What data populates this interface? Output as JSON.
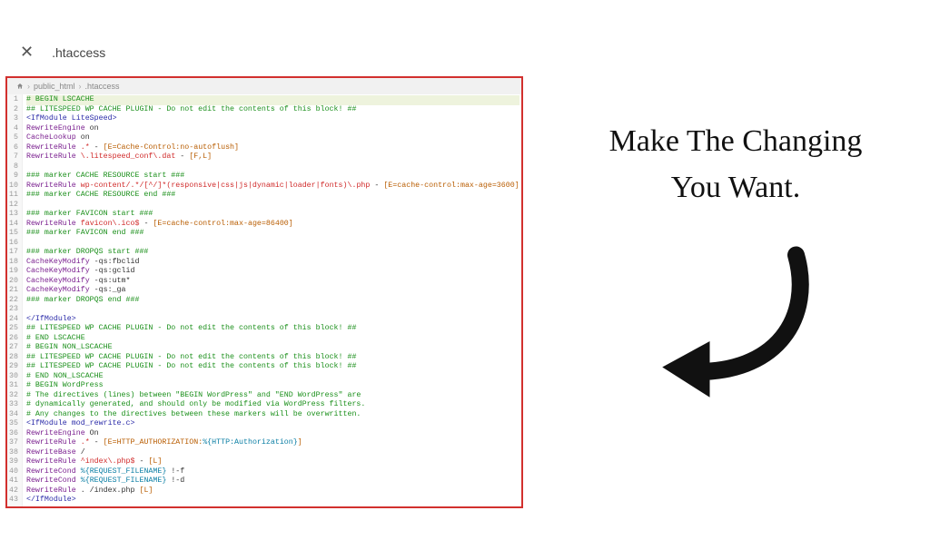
{
  "topbar": {
    "title": ".htaccess"
  },
  "breadcrumb": {
    "items": [
      "public_html",
      ".htaccess"
    ]
  },
  "annotation": {
    "headline_l1": "Make The Changing",
    "headline_l2": "You Want."
  },
  "code": {
    "lines": [
      [
        {
          "c": "t-cmt",
          "t": "# BEGIN LSCACHE"
        }
      ],
      [
        {
          "c": "t-cmt",
          "t": "## LITESPEED WP CACHE PLUGIN - Do not edit the contents of this block! ##"
        }
      ],
      [
        {
          "c": "t-tag",
          "t": "<IfModule LiteSpeed>"
        }
      ],
      [
        {
          "c": "t-kw",
          "t": "RewriteEngine"
        },
        {
          "c": "t-plain",
          "t": " on"
        }
      ],
      [
        {
          "c": "t-kw",
          "t": "CacheLookup"
        },
        {
          "c": "t-plain",
          "t": " on"
        }
      ],
      [
        {
          "c": "t-kw",
          "t": "RewriteRule"
        },
        {
          "c": "t-plain",
          "t": " "
        },
        {
          "c": "t-regex",
          "t": ".*"
        },
        {
          "c": "t-plain",
          "t": " - "
        },
        {
          "c": "t-str",
          "t": "[E=Cache-Control:no-autoflush]"
        }
      ],
      [
        {
          "c": "t-kw",
          "t": "RewriteRule"
        },
        {
          "c": "t-plain",
          "t": " "
        },
        {
          "c": "t-regex",
          "t": "\\.litespeed_conf\\.dat"
        },
        {
          "c": "t-plain",
          "t": " - "
        },
        {
          "c": "t-str",
          "t": "[F,L]"
        }
      ],
      [
        {
          "c": "t-plain",
          "t": ""
        }
      ],
      [
        {
          "c": "t-cmt",
          "t": "### marker CACHE RESOURCE start ###"
        }
      ],
      [
        {
          "c": "t-kw",
          "t": "RewriteRule"
        },
        {
          "c": "t-plain",
          "t": " "
        },
        {
          "c": "t-regex",
          "t": "wp-content/.*/[^/]*(responsive|css|js|dynamic|loader|fonts)\\.php"
        },
        {
          "c": "t-plain",
          "t": " - "
        },
        {
          "c": "t-str",
          "t": "[E=cache-control:max-age=3600]"
        }
      ],
      [
        {
          "c": "t-cmt",
          "t": "### marker CACHE RESOURCE end ###"
        }
      ],
      [
        {
          "c": "t-plain",
          "t": ""
        }
      ],
      [
        {
          "c": "t-cmt",
          "t": "### marker FAVICON start ###"
        }
      ],
      [
        {
          "c": "t-kw",
          "t": "RewriteRule"
        },
        {
          "c": "t-plain",
          "t": " "
        },
        {
          "c": "t-regex",
          "t": "favicon\\.ico$"
        },
        {
          "c": "t-plain",
          "t": " - "
        },
        {
          "c": "t-str",
          "t": "[E=cache-control:max-age=86400]"
        }
      ],
      [
        {
          "c": "t-cmt",
          "t": "### marker FAVICON end ###"
        }
      ],
      [
        {
          "c": "t-plain",
          "t": ""
        }
      ],
      [
        {
          "c": "t-cmt",
          "t": "### marker DROPQS start ###"
        }
      ],
      [
        {
          "c": "t-kw",
          "t": "CacheKeyModify"
        },
        {
          "c": "t-plain",
          "t": " -qs:fbclid"
        }
      ],
      [
        {
          "c": "t-kw",
          "t": "CacheKeyModify"
        },
        {
          "c": "t-plain",
          "t": " -qs:gclid"
        }
      ],
      [
        {
          "c": "t-kw",
          "t": "CacheKeyModify"
        },
        {
          "c": "t-plain",
          "t": " -qs:utm*"
        }
      ],
      [
        {
          "c": "t-kw",
          "t": "CacheKeyModify"
        },
        {
          "c": "t-plain",
          "t": " -qs:_ga"
        }
      ],
      [
        {
          "c": "t-cmt",
          "t": "### marker DROPQS end ###"
        }
      ],
      [
        {
          "c": "t-plain",
          "t": ""
        }
      ],
      [
        {
          "c": "t-tag",
          "t": "</IfModule>"
        }
      ],
      [
        {
          "c": "t-cmt",
          "t": "## LITESPEED WP CACHE PLUGIN - Do not edit the contents of this block! ##"
        }
      ],
      [
        {
          "c": "t-cmt",
          "t": "# END LSCACHE"
        }
      ],
      [
        {
          "c": "t-cmt",
          "t": "# BEGIN NON_LSCACHE"
        }
      ],
      [
        {
          "c": "t-cmt",
          "t": "## LITESPEED WP CACHE PLUGIN - Do not edit the contents of this block! ##"
        }
      ],
      [
        {
          "c": "t-cmt",
          "t": "## LITESPEED WP CACHE PLUGIN - Do not edit the contents of this block! ##"
        }
      ],
      [
        {
          "c": "t-cmt",
          "t": "# END NON_LSCACHE"
        }
      ],
      [
        {
          "c": "t-cmt",
          "t": "# BEGIN WordPress"
        }
      ],
      [
        {
          "c": "t-cmt",
          "t": "# The directives (lines) between \"BEGIN WordPress\" and \"END WordPress\" are"
        }
      ],
      [
        {
          "c": "t-cmt",
          "t": "# dynamically generated, and should only be modified via WordPress filters."
        }
      ],
      [
        {
          "c": "t-cmt",
          "t": "# Any changes to the directives between these markers will be overwritten."
        }
      ],
      [
        {
          "c": "t-tag",
          "t": "<IfModule mod_rewrite.c>"
        }
      ],
      [
        {
          "c": "t-kw",
          "t": "RewriteEngine"
        },
        {
          "c": "t-plain",
          "t": " On"
        }
      ],
      [
        {
          "c": "t-kw",
          "t": "RewriteRule"
        },
        {
          "c": "t-plain",
          "t": " "
        },
        {
          "c": "t-regex",
          "t": ".*"
        },
        {
          "c": "t-plain",
          "t": " - "
        },
        {
          "c": "t-str",
          "t": "[E=HTTP_AUTHORIZATION:"
        },
        {
          "c": "t-lit",
          "t": "%{HTTP:Authorization}"
        },
        {
          "c": "t-str",
          "t": "]"
        }
      ],
      [
        {
          "c": "t-kw",
          "t": "RewriteBase"
        },
        {
          "c": "t-plain",
          "t": " /"
        }
      ],
      [
        {
          "c": "t-kw",
          "t": "RewriteRule"
        },
        {
          "c": "t-plain",
          "t": " "
        },
        {
          "c": "t-regex",
          "t": "^index\\.php$"
        },
        {
          "c": "t-plain",
          "t": " - "
        },
        {
          "c": "t-str",
          "t": "[L]"
        }
      ],
      [
        {
          "c": "t-kw",
          "t": "RewriteCond"
        },
        {
          "c": "t-plain",
          "t": " "
        },
        {
          "c": "t-lit",
          "t": "%{REQUEST_FILENAME}"
        },
        {
          "c": "t-plain",
          "t": " !-f"
        }
      ],
      [
        {
          "c": "t-kw",
          "t": "RewriteCond"
        },
        {
          "c": "t-plain",
          "t": " "
        },
        {
          "c": "t-lit",
          "t": "%{REQUEST_FILENAME}"
        },
        {
          "c": "t-plain",
          "t": " !-d"
        }
      ],
      [
        {
          "c": "t-kw",
          "t": "RewriteRule"
        },
        {
          "c": "t-plain",
          "t": " . /index.php "
        },
        {
          "c": "t-str",
          "t": "[L]"
        }
      ],
      [
        {
          "c": "t-tag",
          "t": "</IfModule>"
        }
      ]
    ],
    "highlight_line": 1
  }
}
